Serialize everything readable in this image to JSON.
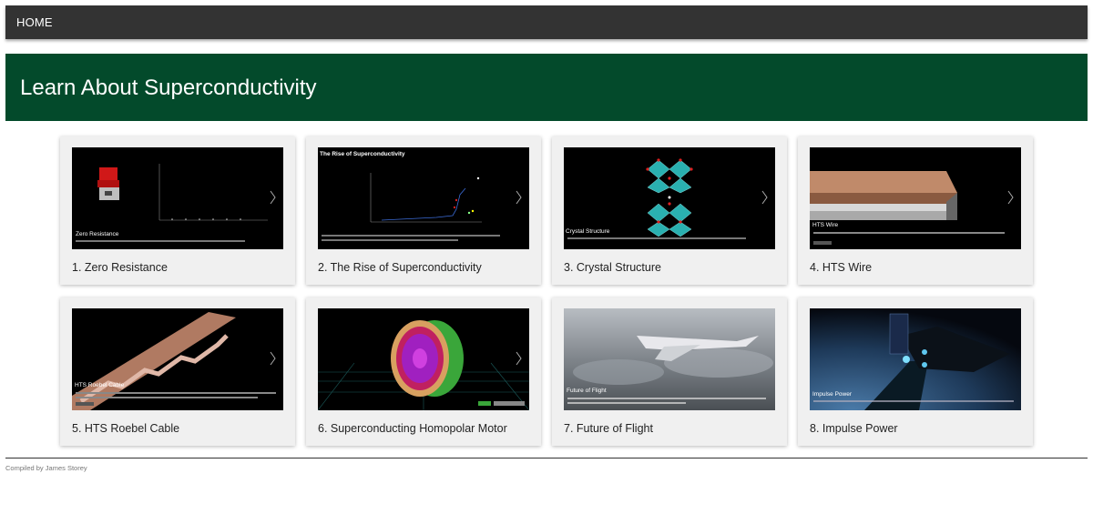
{
  "nav": {
    "home_label": "HOME"
  },
  "banner": {
    "title": "Learn About Superconductivity"
  },
  "cards": [
    {
      "title": "1. Zero Resistance",
      "thumb_caption": "Zero Resistance"
    },
    {
      "title": "2. The Rise of Superconductivity",
      "thumb_caption": "The Rise of Superconductivity"
    },
    {
      "title": "3. Crystal Structure",
      "thumb_caption": "Crystal Structure"
    },
    {
      "title": "4. HTS Wire",
      "thumb_caption": "HTS Wire"
    },
    {
      "title": "5. HTS Roebel Cable",
      "thumb_caption": "HTS Roebel Cable"
    },
    {
      "title": "6. Superconducting Homopolar Motor",
      "thumb_caption": ""
    },
    {
      "title": "7. Future of Flight",
      "thumb_caption": "Future of Flight"
    },
    {
      "title": "8. Impulse Power",
      "thumb_caption": "Impulse Power"
    }
  ],
  "footer": {
    "text": "Compiled by James Storey"
  },
  "colors": {
    "navbar": "#333333",
    "banner": "#034a2b",
    "card": "#f0f0f0"
  }
}
